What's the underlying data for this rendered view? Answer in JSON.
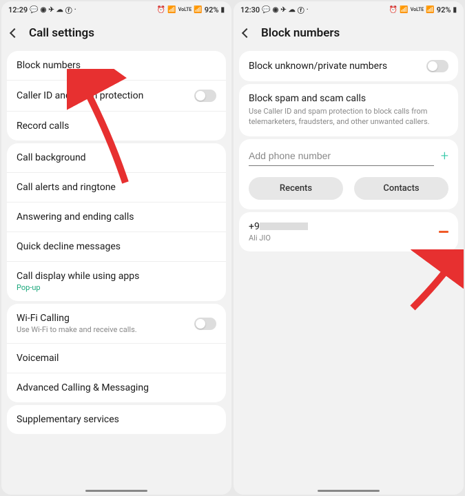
{
  "left": {
    "status": {
      "time": "12:29",
      "battery": "92%"
    },
    "header": {
      "title": "Call settings"
    },
    "group1": [
      {
        "label": "Block numbers"
      },
      {
        "label": "Caller ID and spam protection",
        "toggle": true
      },
      {
        "label": "Record calls"
      }
    ],
    "group2": [
      {
        "label": "Call background"
      },
      {
        "label": "Call alerts and ringtone"
      },
      {
        "label": "Answering and ending calls"
      },
      {
        "label": "Quick decline messages"
      },
      {
        "label": "Call display while using apps",
        "sub": "Pop-up",
        "subGreen": true
      }
    ],
    "group3": [
      {
        "label": "Wi-Fi Calling",
        "sub": "Use Wi-Fi to make and receive calls.",
        "toggle": true
      },
      {
        "label": "Voicemail"
      },
      {
        "label": "Advanced Calling & Messaging"
      }
    ],
    "group4": [
      {
        "label": "Supplementary services"
      }
    ]
  },
  "right": {
    "status": {
      "time": "12:30",
      "battery": "92%"
    },
    "header": {
      "title": "Block numbers"
    },
    "blockUnknown": {
      "label": "Block unknown/private numbers"
    },
    "spam": {
      "title": "Block spam and scam calls",
      "desc": "Use Caller ID and spam protection to block calls from telemarketers, fraudsters, and other unwanted callers."
    },
    "input": {
      "placeholder": "Add phone number"
    },
    "buttons": {
      "recents": "Recents",
      "contacts": "Contacts"
    },
    "blocked": {
      "number": "+9",
      "name": "Ali JIO"
    }
  }
}
